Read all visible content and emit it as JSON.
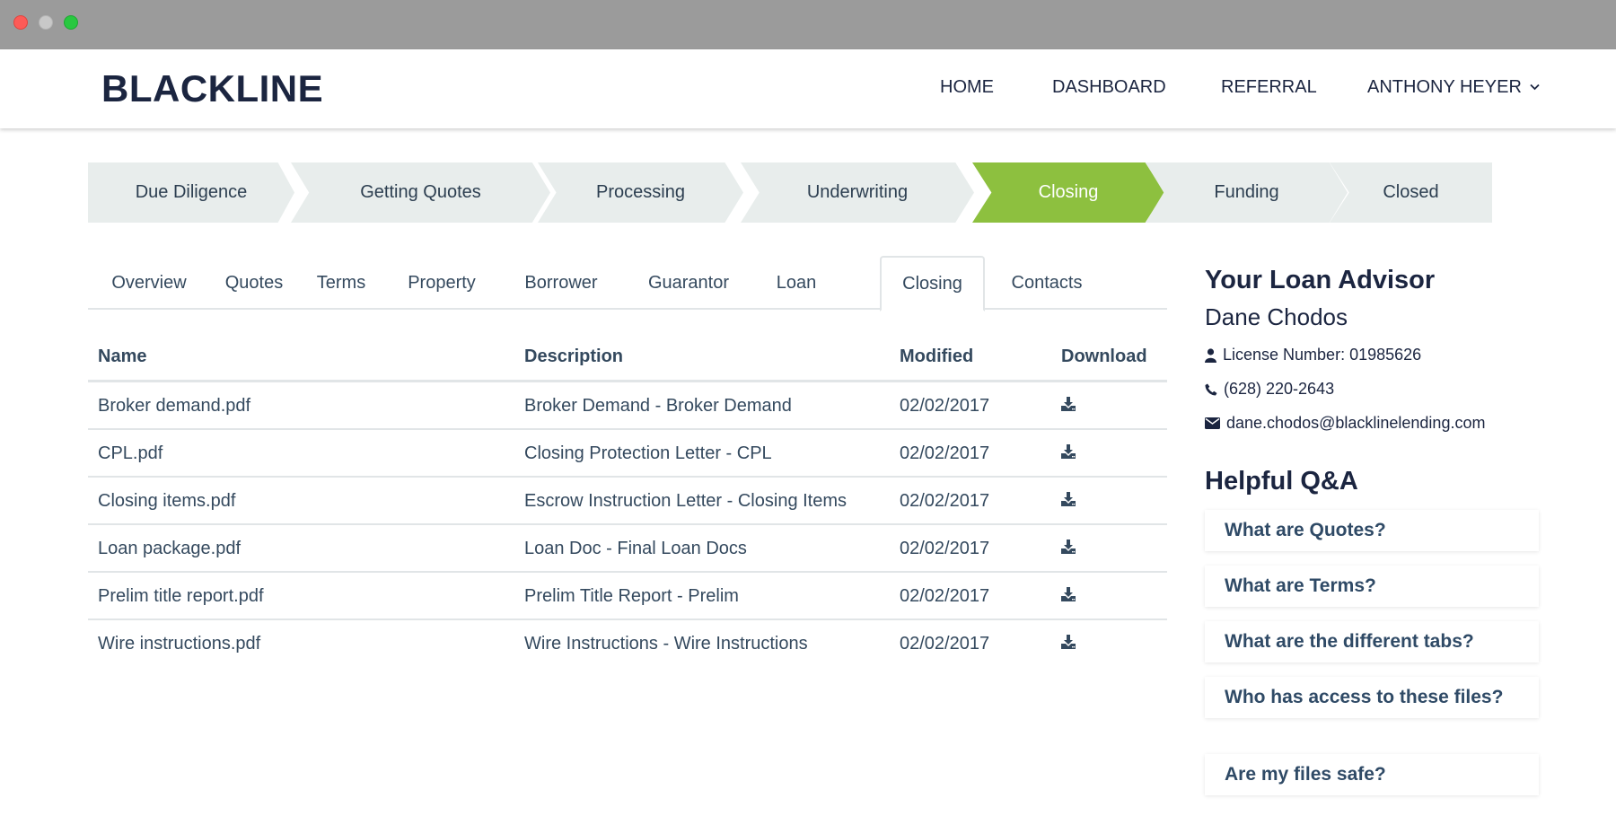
{
  "window": {
    "controls": [
      "close",
      "minimize",
      "maximize"
    ]
  },
  "header": {
    "logo": "BLACKLINE",
    "nav": [
      {
        "label": "HOME"
      },
      {
        "label": "DASHBOARD"
      },
      {
        "label": "REFERRAL"
      },
      {
        "label": "ANTHONY HEYER",
        "icon": "chevron-down-icon"
      }
    ]
  },
  "steps": [
    {
      "label": "Due Diligence",
      "active": false
    },
    {
      "label": "Getting Quotes",
      "active": false
    },
    {
      "label": "Processing",
      "active": false
    },
    {
      "label": "Underwriting",
      "active": false
    },
    {
      "label": "Closing",
      "active": true
    },
    {
      "label": "Funding",
      "active": false
    },
    {
      "label": "Closed",
      "active": false
    }
  ],
  "tabs": [
    {
      "label": "Overview",
      "active": false
    },
    {
      "label": "Quotes",
      "active": false
    },
    {
      "label": "Terms",
      "active": false
    },
    {
      "label": "Property",
      "active": false
    },
    {
      "label": "Borrower",
      "active": false
    },
    {
      "label": "Guarantor",
      "active": false
    },
    {
      "label": "Loan",
      "active": false
    },
    {
      "label": "Closing",
      "active": true
    },
    {
      "label": "Contacts",
      "active": false
    }
  ],
  "table": {
    "headers": {
      "name": "Name",
      "description": "Description",
      "modified": "Modified",
      "download": "Download"
    },
    "rows": [
      {
        "name": "Broker demand.pdf",
        "description": "Broker Demand - Broker Demand",
        "modified": "02/02/2017",
        "icon": "download-icon"
      },
      {
        "name": "CPL.pdf",
        "description": "Closing Protection Letter - CPL",
        "modified": "02/02/2017",
        "icon": "download-icon"
      },
      {
        "name": "Closing items.pdf",
        "description": "Escrow Instruction Letter - Closing Items",
        "modified": "02/02/2017",
        "icon": "download-icon"
      },
      {
        "name": "Loan package.pdf",
        "description": "Loan Doc - Final Loan Docs",
        "modified": "02/02/2017",
        "icon": "download-icon"
      },
      {
        "name": "Prelim title report.pdf",
        "description": "Prelim Title Report - Prelim",
        "modified": "02/02/2017",
        "icon": "download-icon"
      },
      {
        "name": "Wire instructions.pdf",
        "description": "Wire Instructions - Wire Instructions",
        "modified": "02/02/2017",
        "icon": "download-icon"
      }
    ]
  },
  "advisor": {
    "title": "Your Loan Advisor",
    "name": "Dane Chodos",
    "license": "License Number: 01985626",
    "phone": "(628) 220-2643",
    "email": "dane.chodos@blacklinelending.com"
  },
  "qa": {
    "title": "Helpful Q&A",
    "items": [
      "What are Quotes?",
      "What are Terms?",
      "What are the different tabs?",
      "Who has access to these files?",
      "Are my files safe?"
    ]
  },
  "colors": {
    "brand_dark": "#1b2540",
    "active_step": "#8dc03f",
    "step_bg": "#e8edec",
    "titlebar": "#9b9b9b"
  }
}
